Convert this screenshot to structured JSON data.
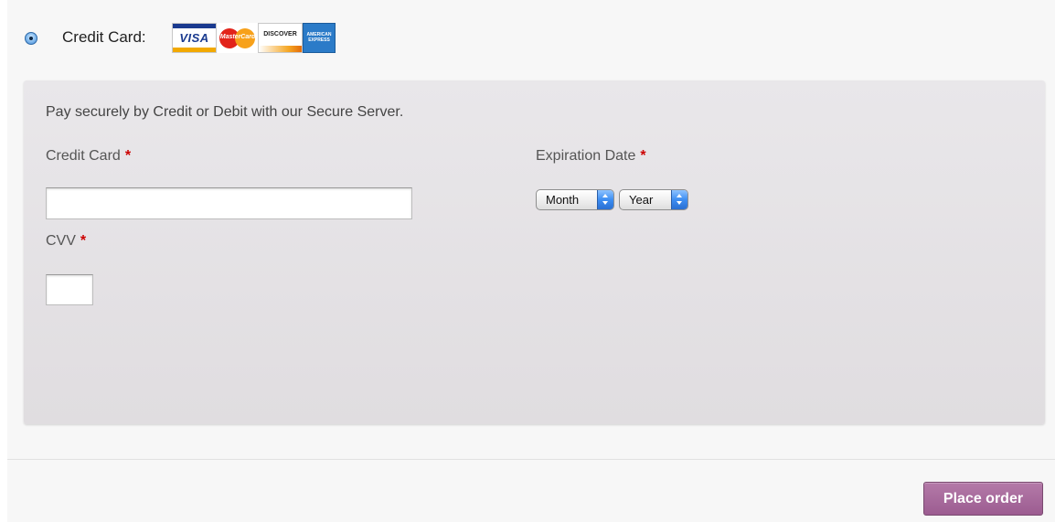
{
  "payment_method": {
    "label": "Credit Card:",
    "selected": true,
    "card_logos": [
      {
        "name": "visa-logo",
        "text": "VISA"
      },
      {
        "name": "mastercard-logo",
        "text": "MasterCard"
      },
      {
        "name": "discover-logo",
        "text": "DISCOVER"
      },
      {
        "name": "amex-logo",
        "text": "AMERICAN EXPRESS"
      }
    ]
  },
  "panel": {
    "description": "Pay securely by Credit or Debit with our Secure Server.",
    "credit_card_label": "Credit Card",
    "expiration_label": "Expiration Date",
    "cvv_label": "CVV",
    "required_marker": "*",
    "credit_card_value": "",
    "cvv_value": "",
    "month_select": "Month",
    "year_select": "Year"
  },
  "footer": {
    "place_order_label": "Place order"
  },
  "colors": {
    "accent": "#9c5c91",
    "required": "#cc0000",
    "panel_bg": "#e4e1e4"
  }
}
